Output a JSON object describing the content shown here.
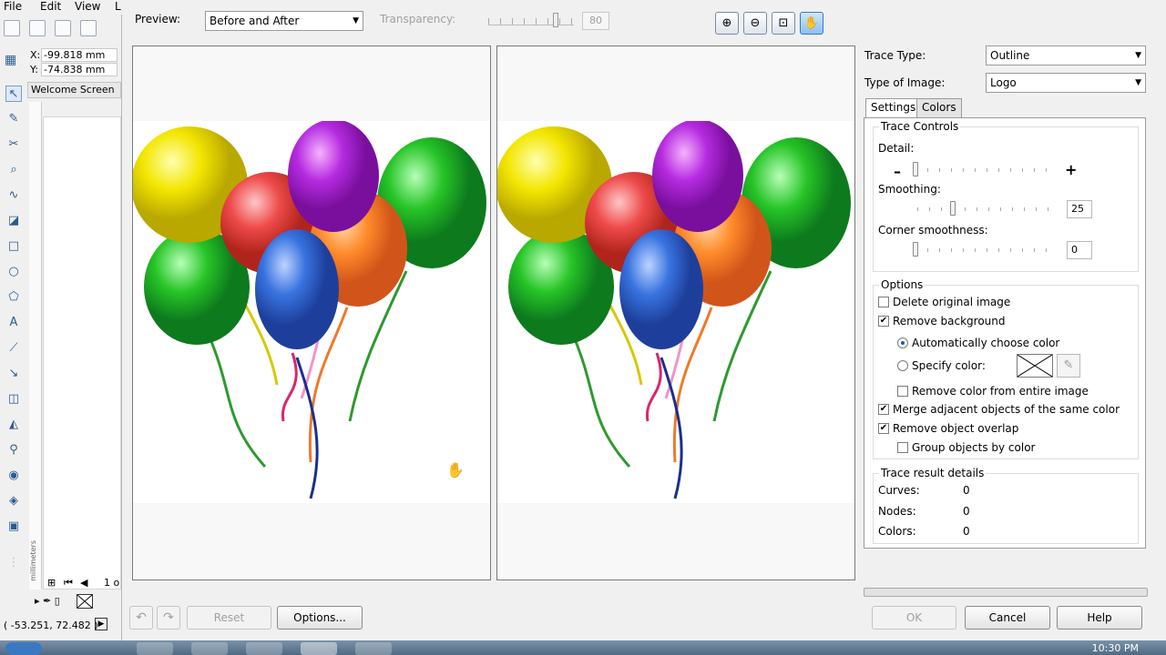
{
  "host": {
    "menu": [
      "File",
      "Edit",
      "View",
      "L"
    ],
    "coords": {
      "x_label": "X:",
      "x_value": "-99.818 mm",
      "y_label": "Y:",
      "y_value": "-74.838 mm"
    },
    "welcome_tab": "Welcome Screen",
    "page_indicator": "1 o",
    "ruler_unit": "millimeters",
    "status_coords": "( -53.251, 72.482 )"
  },
  "dialog": {
    "preview_label": "Preview:",
    "preview_value": "Before and After",
    "transparency_label": "Transparency:",
    "transparency_value": "80",
    "transparency_level": 0.8,
    "zoom_tools": [
      "zoom-in",
      "zoom-out",
      "zoom-fit",
      "pan"
    ],
    "trace_type_label": "Trace Type:",
    "trace_type_value": "Outline",
    "image_type_label": "Type of Image:",
    "image_type_value": "Logo",
    "tabs": [
      "Settings",
      "Colors"
    ],
    "trace_controls": {
      "title": "Trace Controls",
      "detail_label": "Detail:",
      "detail_minus": "–",
      "detail_plus": "+",
      "detail_level": 0.0,
      "smoothing_label": "Smoothing:",
      "smoothing_value": "25",
      "smoothing_level": 0.25,
      "corner_label": "Corner smoothness:",
      "corner_value": "0",
      "corner_level": 0.0
    },
    "options": {
      "title": "Options",
      "delete_original": "Delete original image",
      "remove_background": "Remove background",
      "auto_color": "Automatically choose color",
      "specify_color": "Specify color:",
      "remove_entire": "Remove color from entire image",
      "merge_adjacent": "Merge adjacent objects of the same color",
      "remove_overlap": "Remove object overlap",
      "group_by_color": "Group objects by color"
    },
    "results": {
      "title": "Trace result details",
      "curves_label": "Curves:",
      "curves_value": "0",
      "nodes_label": "Nodes:",
      "nodes_value": "0",
      "colors_label": "Colors:",
      "colors_value": "0"
    },
    "buttons": {
      "reset": "Reset",
      "options": "Options...",
      "ok": "OK",
      "cancel": "Cancel",
      "help": "Help"
    }
  },
  "taskbar": {
    "clock": "10:30 PM"
  },
  "colors": {
    "accent": "#3a7ab7",
    "dialog_bg": "#f0f0f0"
  }
}
